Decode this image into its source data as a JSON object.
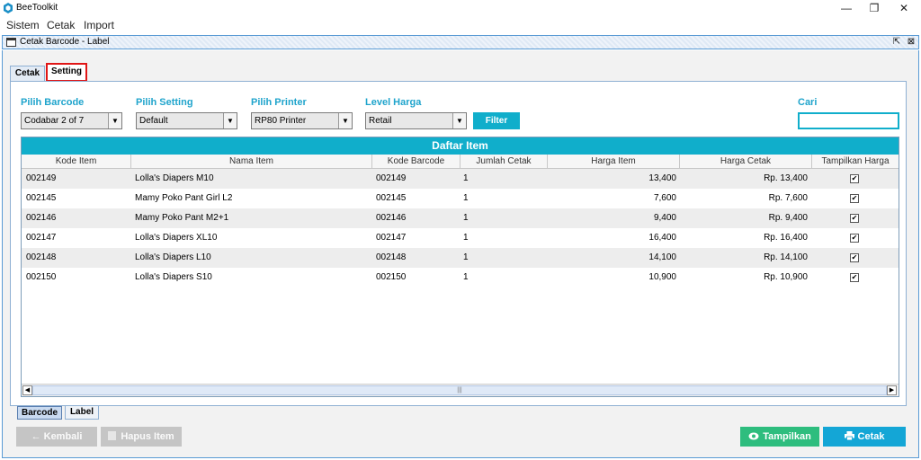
{
  "app": {
    "title": "BeeToolkit",
    "window_controls": {
      "minimize": "—",
      "restore": "❐",
      "close": "✕"
    }
  },
  "menu": {
    "items": [
      "Sistem",
      "Cetak",
      "Import"
    ]
  },
  "frame": {
    "title": "Cetak Barcode - Label",
    "maximize_glyph": "⇱",
    "close_glyph": "⊠"
  },
  "tabs": [
    {
      "label": "Cetak",
      "active": false
    },
    {
      "label": "Setting",
      "active": true
    }
  ],
  "filters": {
    "barcode": {
      "label": "Pilih Barcode",
      "value": "Codabar 2 of 7"
    },
    "setting": {
      "label": "Pilih Setting",
      "value": "Default"
    },
    "printer": {
      "label": "Pilih Printer",
      "value": "RP80 Printer"
    },
    "harga": {
      "label": "Level Harga",
      "value": "Retail"
    },
    "filter_button": "Filter",
    "search": {
      "label": "Cari",
      "value": ""
    }
  },
  "table": {
    "title": "Daftar Item",
    "columns": [
      "Kode Item",
      "Nama Item",
      "Kode Barcode",
      "Jumlah Cetak",
      "Harga Item",
      "Harga Cetak",
      "Tampilkan Harga"
    ],
    "rows": [
      {
        "kode": "002149",
        "nama": "Lolla's Diapers M10",
        "barcode": "002149",
        "jumlah": "1",
        "harga": "13,400",
        "cetak": "Rp. 13,400",
        "tampil": true
      },
      {
        "kode": "002145",
        "nama": "Mamy Poko Pant Girl L2",
        "barcode": "002145",
        "jumlah": "1",
        "harga": "7,600",
        "cetak": "Rp. 7,600",
        "tampil": true
      },
      {
        "kode": "002146",
        "nama": "Mamy Poko Pant M2+1",
        "barcode": "002146",
        "jumlah": "1",
        "harga": "9,400",
        "cetak": "Rp. 9,400",
        "tampil": true
      },
      {
        "kode": "002147",
        "nama": "Lolla's Diapers XL10",
        "barcode": "002147",
        "jumlah": "1",
        "harga": "16,400",
        "cetak": "Rp. 16,400",
        "tampil": true
      },
      {
        "kode": "002148",
        "nama": "Lolla's Diapers L10",
        "barcode": "002148",
        "jumlah": "1",
        "harga": "14,100",
        "cetak": "Rp. 14,100",
        "tampil": true
      },
      {
        "kode": "002150",
        "nama": "Lolla's Diapers S10",
        "barcode": "002150",
        "jumlah": "1",
        "harga": "10,900",
        "cetak": "Rp. 10,900",
        "tampil": true
      }
    ],
    "check_glyph": "✔",
    "scroll_grip": "|||"
  },
  "bottom_tabs": [
    {
      "label": "Barcode",
      "active": true
    },
    {
      "label": "Label",
      "active": false
    }
  ],
  "buttons": {
    "back": "← Kembali",
    "delete": "Hapus Item",
    "preview": "Tampilkan",
    "print": "Cetak"
  },
  "icons": {
    "back": "arrow-left-icon",
    "delete": "trash-icon",
    "preview": "eye-icon",
    "print": "printer-icon"
  },
  "colors": {
    "accent": "#10aecb",
    "preview": "#2ebd7e",
    "print": "#14a6d6",
    "disabled": "#c5c5c5",
    "highlight": "#e01515"
  }
}
